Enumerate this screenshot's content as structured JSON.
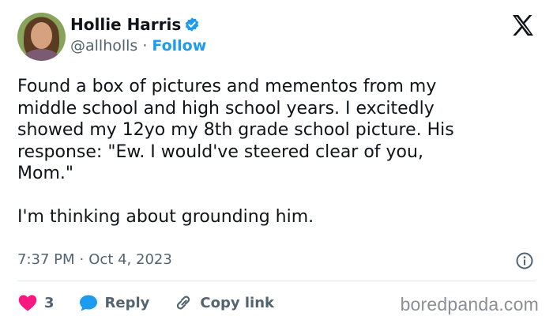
{
  "user": {
    "display_name": "Hollie Harris",
    "handle": "@allholls",
    "separator": "·",
    "follow_label": "Follow",
    "verified": true
  },
  "tweet": {
    "text": "Found a box of pictures and mementos from my\nmiddle school and high school years. I excitedly\nshowed my 12yo my 8th grade school picture. His\nresponse: \"Ew. I would've steered clear of you,\nMom.\"\n\nI'm thinking about grounding him.",
    "time": "7:37 PM",
    "separator": "·",
    "date": "Oct 4, 2023"
  },
  "actions": {
    "like_count": "3",
    "reply_label": "Reply",
    "copy_link_label": "Copy link"
  },
  "watermark": "boredpanda.com",
  "colors": {
    "accent": "#1d9bf0",
    "like": "#f91880",
    "text": "#0f1419",
    "muted": "#536471"
  },
  "icons": [
    "verified-badge-icon",
    "x-logo-icon",
    "info-icon",
    "heart-icon",
    "reply-bubble-icon",
    "link-icon"
  ]
}
